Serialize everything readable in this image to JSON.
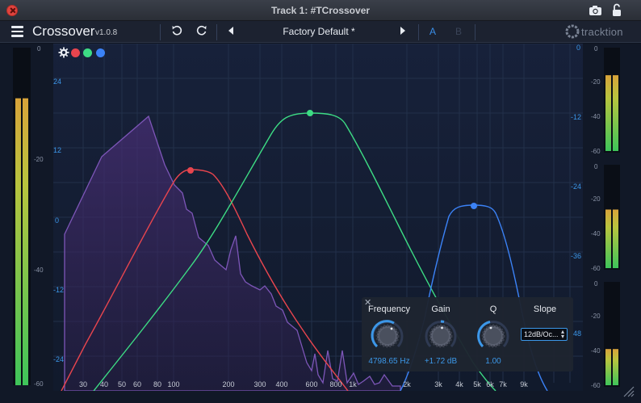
{
  "window": {
    "title": "Track 1: #TCrossover"
  },
  "header": {
    "plugin_name": "Crossover",
    "version": "v1.0.8",
    "preset": "Factory Default *",
    "ab_a": "A",
    "ab_b": "B",
    "brand": "tracktion"
  },
  "left_meter": {
    "scale": [
      "0",
      "-20",
      "-40",
      "-60"
    ],
    "level_db": [
      -9,
      -9
    ]
  },
  "graph": {
    "left_scale": [
      "24",
      "12",
      "0",
      "-12",
      "-24"
    ],
    "right_scale": [
      "0",
      "-12",
      "-24",
      "-36",
      "-48"
    ],
    "freq_labels": [
      "30",
      "40",
      "50",
      "60",
      "80",
      "100",
      "200",
      "300",
      "400",
      "600",
      "800",
      "1k",
      "2k",
      "3k",
      "4k",
      "5k",
      "6k",
      "7k",
      "9k"
    ]
  },
  "bands": {
    "colors": {
      "red": "#e8454e",
      "green": "#3ddc84",
      "blue": "#3b82f6",
      "analyzer": "#7d56b8"
    }
  },
  "right_meters": [
    {
      "scale": [
        "0",
        "-20",
        "-40",
        "-60"
      ],
      "level_db": [
        -16,
        -16
      ]
    },
    {
      "scale": [
        "0",
        "-20",
        "-40",
        "-60"
      ],
      "level_db": [
        -26,
        -26
      ]
    },
    {
      "scale": [
        "0",
        "-20",
        "-40",
        "-60"
      ],
      "level_db": [
        -39,
        -39
      ]
    }
  ],
  "band_panel": {
    "frequency_label": "Frequency",
    "frequency_value": "4798.65 Hz",
    "gain_label": "Gain",
    "gain_value": "+1.72 dB",
    "q_label": "Q",
    "q_value": "1.00",
    "slope_label": "Slope",
    "slope_value": "12dB/Oc..."
  }
}
